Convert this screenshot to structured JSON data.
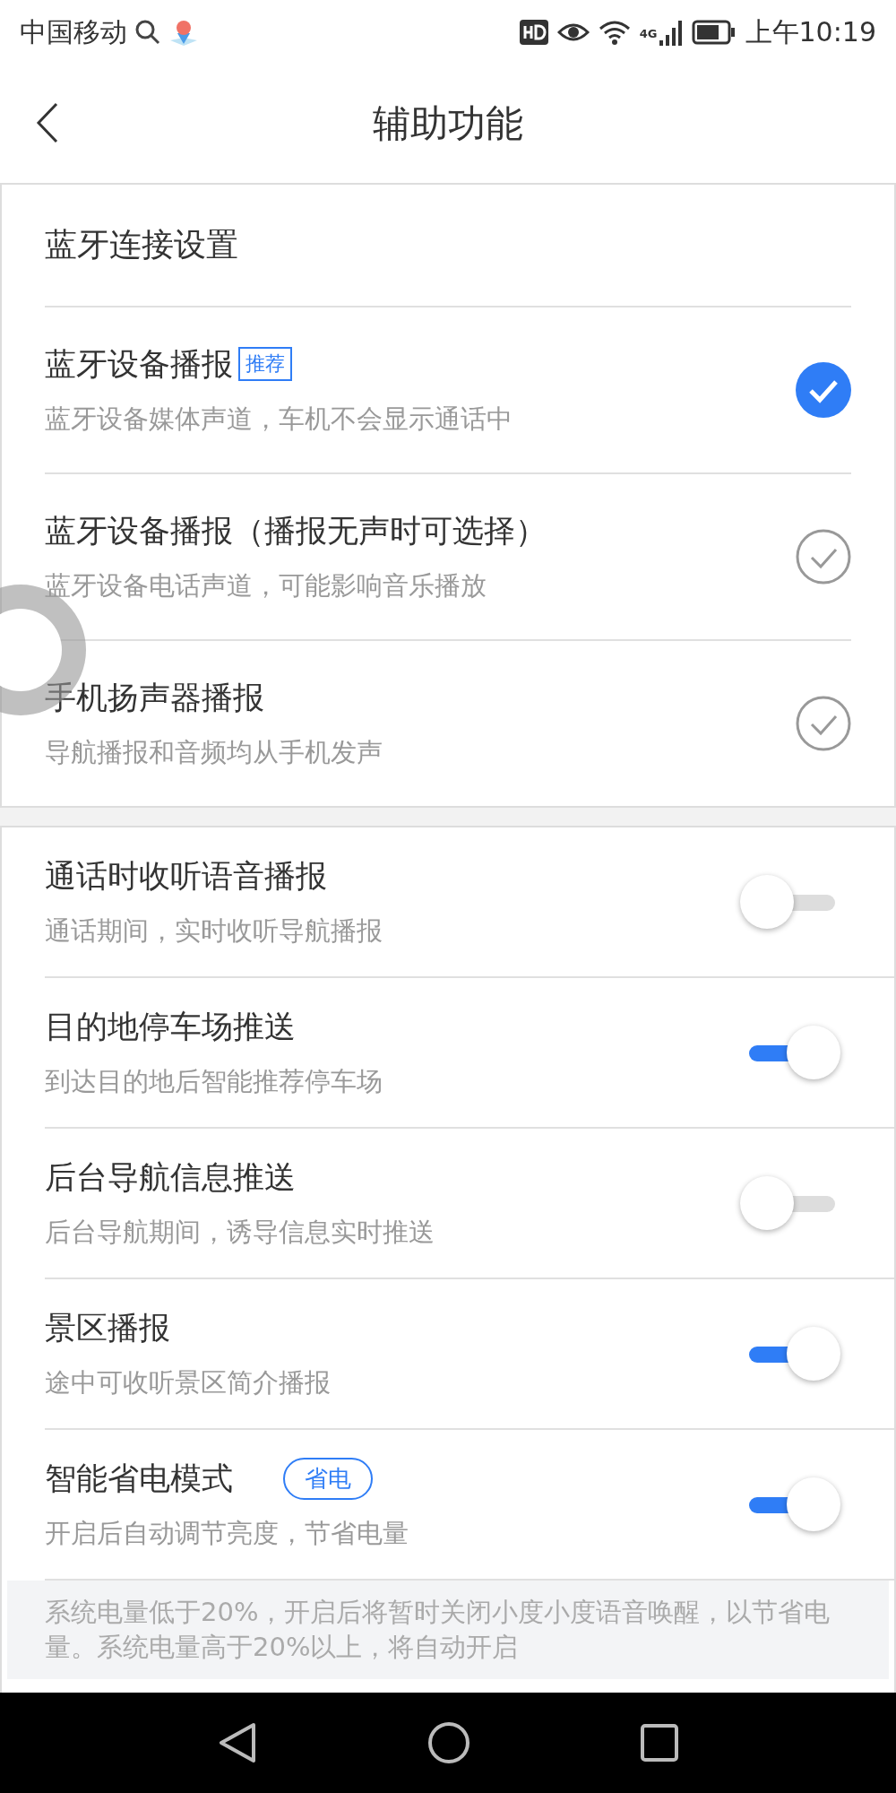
{
  "status_bar": {
    "carrier": "中国移动",
    "network": "4G",
    "time": "上午10:19"
  },
  "header": {
    "title": "辅助功能"
  },
  "bluetooth_section": {
    "title": "蓝牙连接设置",
    "options": [
      {
        "title": "蓝牙设备播报",
        "badge": "推荐",
        "subtitle": "蓝牙设备媒体声道，车机不会显示通话中",
        "selected": true
      },
      {
        "title": "蓝牙设备播报（播报无声时可选择）",
        "subtitle": "蓝牙设备电话声道，可能影响音乐播放",
        "selected": false
      },
      {
        "title": "手机扬声器播报",
        "subtitle": "导航播报和音频均从手机发声",
        "selected": false
      }
    ]
  },
  "toggles": [
    {
      "title": "通话时收听语音播报",
      "subtitle": "通话期间，实时收听导航播报",
      "on": false
    },
    {
      "title": "目的地停车场推送",
      "subtitle": "到达目的地后智能推荐停车场",
      "on": true
    },
    {
      "title": "后台导航信息推送",
      "subtitle": "后台导航期间，诱导信息实时推送",
      "on": false
    },
    {
      "title": "景区播报",
      "subtitle": "途中可收听景区简介播报",
      "on": true
    },
    {
      "title": "智能省电模式",
      "badge": "省电",
      "subtitle": "开启后自动调节亮度，节省电量",
      "on": true,
      "note": "系统电量低于20%，开启后将暂时关闭小度小度语音唤醒，以节省电量。系统电量高于20%以上，将自动开启"
    }
  ]
}
